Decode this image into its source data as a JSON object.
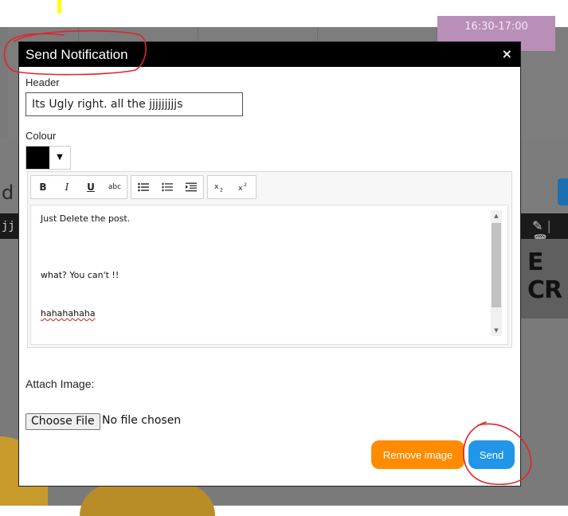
{
  "background": {
    "event_time": "16:30-17:00",
    "side_text": "d",
    "strip_text": "jj",
    "poster_text": "E CR"
  },
  "modal": {
    "title": "Send Notification",
    "close_glyph": "×",
    "header_label": "Header",
    "header_value": "Its Ugly right. all the jjjjjjjjjs",
    "colour_label": "Colour",
    "colour_value": "#000000",
    "toolbar": {
      "bold": "B",
      "italic": "I",
      "underline": "U",
      "strike": "abc",
      "subscript_icon": "subscript-icon",
      "superscript_icon": "superscript-icon"
    },
    "editor_lines": [
      "Just Delete the post.",
      "what? You can't !!",
      "hahahahaha"
    ],
    "attach_label": "Attach Image:",
    "file_button_label": "Choose File",
    "file_status": "No file chosen",
    "remove_image_label": "Remove image",
    "send_label": "Send"
  },
  "colors": {
    "modal_header": "#000000",
    "remove_button": "#ff8c00",
    "send_button": "#2196e8",
    "annotation": "#e0242a"
  }
}
